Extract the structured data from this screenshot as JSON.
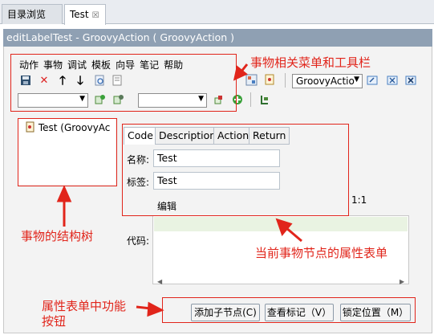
{
  "tabs": [
    {
      "label": "目录浏览"
    },
    {
      "label": "Test",
      "close": "☒"
    }
  ],
  "editor_title": "editLabelTest - GroovyAction ( GroovyAction )",
  "menu": [
    "动作",
    "事物",
    "调试",
    "模板",
    "向导",
    "笔记",
    "帮助"
  ],
  "toolbar": {
    "action_combo_value": "GroovyActio"
  },
  "tree": {
    "item_label": "Test (GroovyAc"
  },
  "form": {
    "tabs": [
      "Code",
      "Description",
      "Action",
      "Return"
    ],
    "name_label": "名称:",
    "name_value": "Test",
    "tag_label": "标签:",
    "tag_value": "Test",
    "edit_link": "编辑",
    "cursor_pos": "1:1",
    "code_label": "代码:"
  },
  "buttons": {
    "add_child": "添加子节点(C)",
    "view_tag": "查看标记（V）",
    "lock_pos": "锁定位置（M）"
  },
  "annotations": {
    "menu_toolbar": "事物相关菜单和工具栏",
    "tree": "事物的结构树",
    "form": "当前事物节点的属性表单",
    "buttons_line1": "属性表单中功能",
    "buttons_line2": "按钮"
  },
  "colors": {
    "annotation": "#e1251b",
    "title_bar": "#8fa0b3"
  }
}
